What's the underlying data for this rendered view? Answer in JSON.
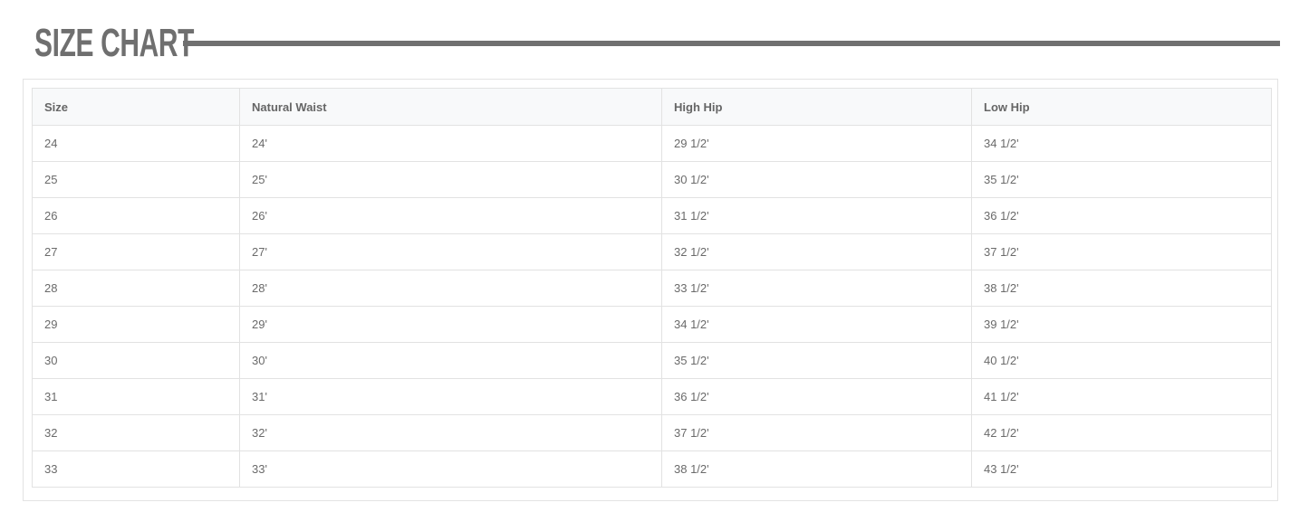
{
  "header": {
    "title": "SIZE CHART"
  },
  "table": {
    "columns": [
      "Size",
      "Natural Waist",
      "High Hip",
      "Low Hip"
    ],
    "rows": [
      [
        "24",
        "24'",
        "29 1/2'",
        "34 1/2'"
      ],
      [
        "25",
        "25'",
        "30 1/2'",
        "35 1/2'"
      ],
      [
        "26",
        "26'",
        "31 1/2'",
        "36 1/2'"
      ],
      [
        "27",
        "27'",
        "32 1/2'",
        "37 1/2'"
      ],
      [
        "28",
        "28'",
        "33 1/2'",
        "38 1/2'"
      ],
      [
        "29",
        "29'",
        "34 1/2'",
        "39 1/2'"
      ],
      [
        "30",
        "30'",
        "35 1/2'",
        "40 1/2'"
      ],
      [
        "31",
        "31'",
        "36 1/2'",
        "41 1/2'"
      ],
      [
        "32",
        "32'",
        "37 1/2'",
        "42 1/2'"
      ],
      [
        "33",
        "33'",
        "38 1/2'",
        "43 1/2'"
      ]
    ]
  },
  "colors": {
    "title": "#6f6f6f",
    "rule": "#707070",
    "border": "#e2e2e2",
    "header_bg": "#f8f9fa",
    "text": "#6a6a6a"
  }
}
